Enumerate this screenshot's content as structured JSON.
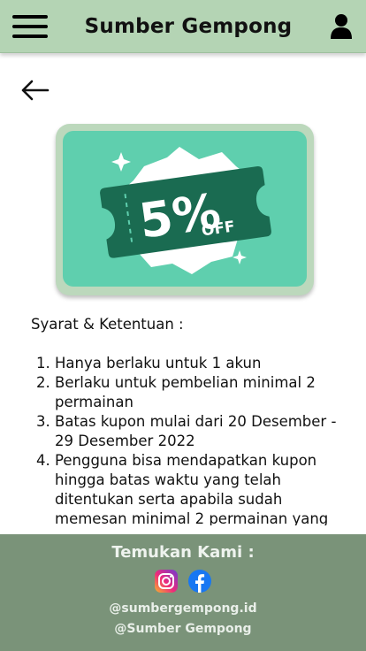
{
  "header": {
    "title": "Sumber Gempong",
    "menu_icon": "hamburger-menu-icon",
    "user_icon": "user-icon"
  },
  "navigation": {
    "back_icon": "arrow-left-icon"
  },
  "coupon": {
    "discount": "5%",
    "off_label": "OFF",
    "colors": {
      "frame": "#bcd8bc",
      "card": "#5fcfae",
      "ticket": "#1a6b51",
      "burst": "#ffffff"
    }
  },
  "terms": {
    "title": "Syarat & Ketentuan :",
    "items": [
      "Hanya berlaku untuk 1 akun",
      "Berlaku untuk pembelian minimal 2 permainan",
      "Batas kupon mulai dari 20 Desember - 29 Desember 2022",
      "Pengguna bisa mendapatkan kupon hingga batas waktu yang telah ditentukan serta apabila sudah memesan minimal 2 permainan yang"
    ]
  },
  "footer": {
    "title": "Temukan Kami :",
    "instagram_icon": "instagram-icon",
    "facebook_icon": "facebook-icon",
    "instagram_handle": "@sumbergempong.id",
    "facebook_handle": "@Sumber Gempong",
    "colors": {
      "background": "#7a9379"
    }
  }
}
